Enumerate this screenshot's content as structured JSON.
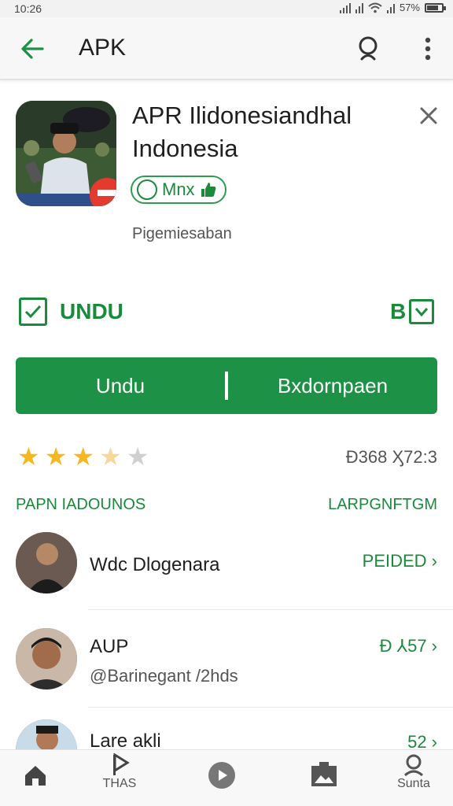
{
  "status_bar": {
    "time": "10:26",
    "battery_text": "57%"
  },
  "app_bar": {
    "title": "APK"
  },
  "app": {
    "title": "APR Ilidonesiandhal Indonesia",
    "badge_text": "Mnx",
    "subtitle": "Pigemiesaban"
  },
  "check_row": {
    "left_label": "UNDU",
    "right_label": "B"
  },
  "buttons": {
    "left": "Undu",
    "right": "Bxdornpaen"
  },
  "rating": {
    "stars": 3.5,
    "max": 5,
    "count_text": "Ɖ368 Ӽ72:3"
  },
  "section": {
    "left": "PAPN IADOUNOS",
    "right": "LARPGNFTGM"
  },
  "items": [
    {
      "name": "Wdc Dlogenara",
      "sub": "",
      "right": "PEIDED ›"
    },
    {
      "name": "AUP",
      "sub": "@Barinegant /2hds",
      "right": "Ɖ ⅄57 ›"
    },
    {
      "name": "Lare akli",
      "sub": "",
      "right": "52 ›"
    }
  ],
  "bottom_nav": [
    {
      "label": "",
      "icon": "home-icon"
    },
    {
      "label": "THAS",
      "icon": "play-flag-icon"
    },
    {
      "label": "",
      "icon": "play-circle-icon"
    },
    {
      "label": "",
      "icon": "image-icon"
    },
    {
      "label": "Sunta",
      "icon": "account-icon"
    }
  ],
  "colors": {
    "accent": "#1d9145",
    "star": "#f5b820",
    "star_empty": "#d0d0d0"
  }
}
